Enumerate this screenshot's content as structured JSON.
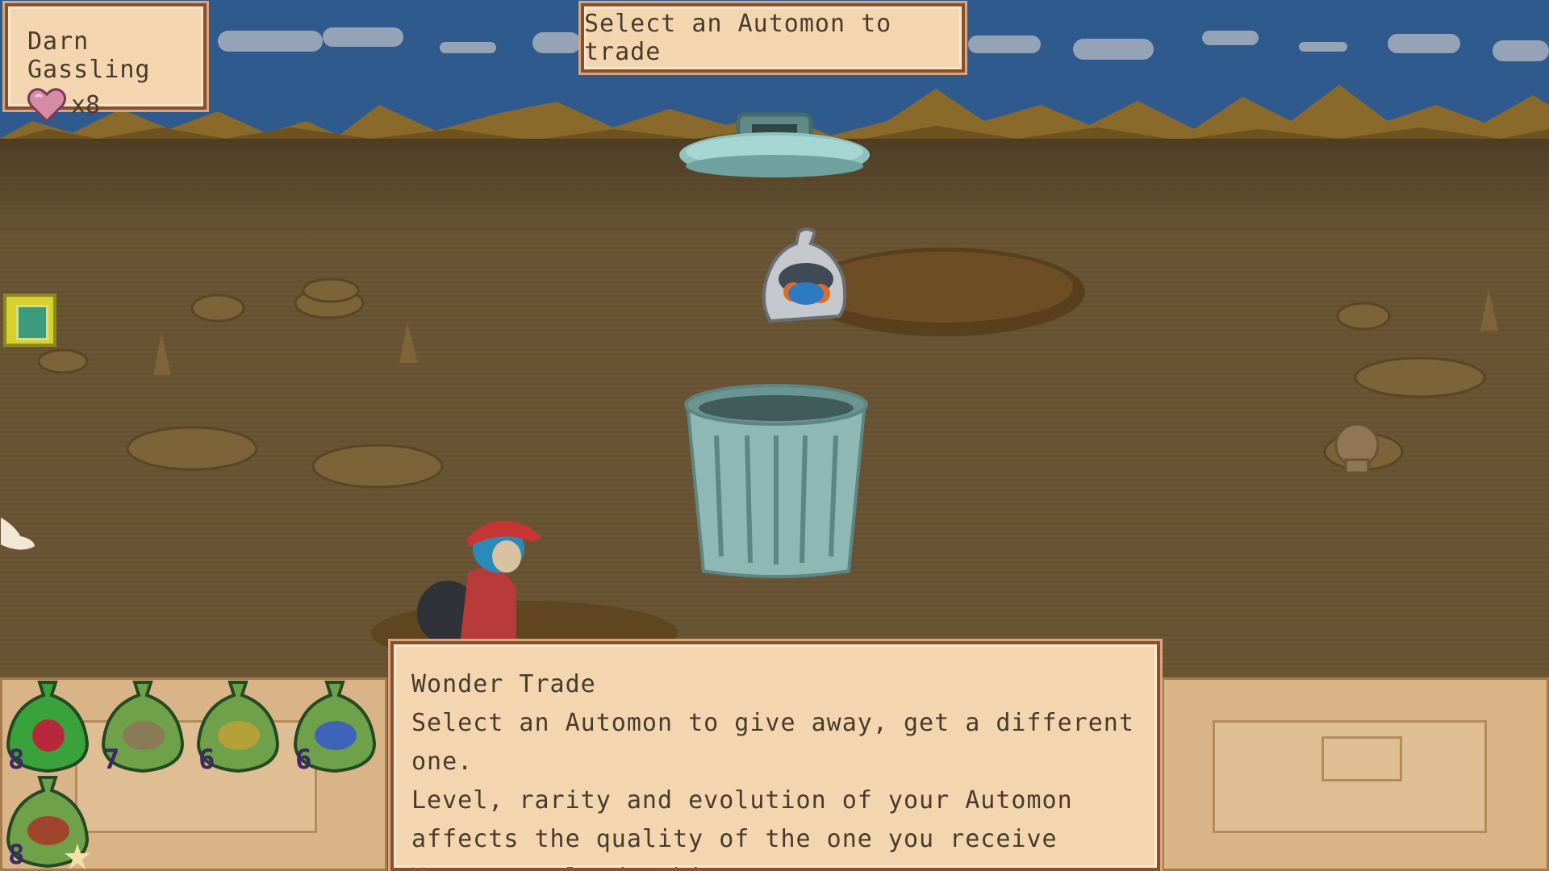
{
  "player": {
    "name": "Darn Gassling",
    "lives_label": "x8",
    "heart_icon": "heart-icon"
  },
  "header": {
    "prompt": "Select an Automon to trade"
  },
  "dialog": {
    "title": "Wonder Trade",
    "line1": "Select an Automon to give away, get a different one.",
    "line2": "Level, rarity and evolution of your Automon",
    "line3": "affects the quality of the one you receive",
    "warning": "You can only do this once"
  },
  "party": [
    {
      "level": "8",
      "color": "#3aa23a"
    },
    {
      "level": "7",
      "color": "#8a7a55"
    },
    {
      "level": "6",
      "color": "#b4a236"
    },
    {
      "level": "6",
      "color": "#3e64b8"
    },
    {
      "level": "8",
      "color": "#a0442c"
    }
  ],
  "colors": {
    "panel_bg": "#f3d6b0",
    "panel_border": "#8a4f2f",
    "text": "#4a3a2c",
    "warning_text": "#a0501a",
    "sky": "#2f5a8e",
    "ground": "#6a5535"
  }
}
